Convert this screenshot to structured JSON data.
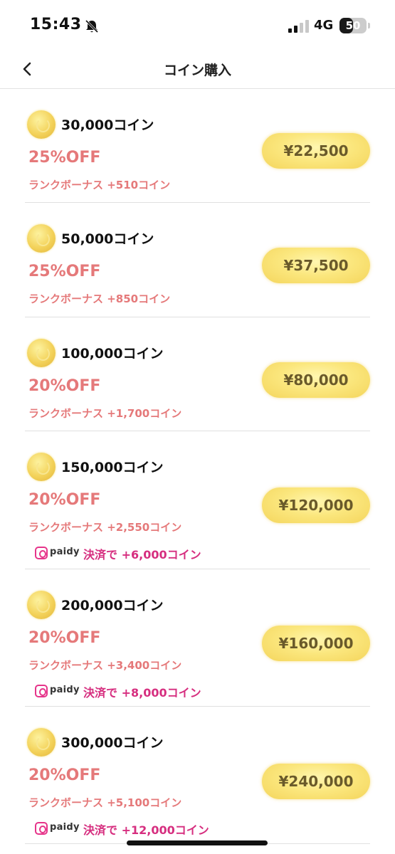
{
  "status_bar": {
    "time": "15:43",
    "network": "4G",
    "battery": "50",
    "battery_level_percent": 50
  },
  "nav": {
    "title": "コイン購入",
    "back_icon": "chevron-left-icon"
  },
  "items": [
    {
      "coins": "30,000コイン",
      "discount": "25%OFF",
      "bonus": "ランクボーナス +510コイン",
      "price": "¥22,500"
    },
    {
      "coins": "50,000コイン",
      "discount": "25%OFF",
      "bonus": "ランクボーナス +850コイン",
      "price": "¥37,500"
    },
    {
      "coins": "100,000コイン",
      "discount": "20%OFF",
      "bonus": "ランクボーナス +1,700コイン",
      "price": "¥80,000"
    },
    {
      "coins": "150,000コイン",
      "discount": "20%OFF",
      "bonus": "ランクボーナス +2,550コイン",
      "paidy_label": "paidy",
      "paidy_promo": "決済で +6,000コイン",
      "price": "¥120,000"
    },
    {
      "coins": "200,000コイン",
      "discount": "20%OFF",
      "bonus": "ランクボーナス +3,400コイン",
      "paidy_label": "paidy",
      "paidy_promo": "決済で +8,000コイン",
      "price": "¥160,000"
    },
    {
      "coins": "300,000コイン",
      "discount": "20%OFF",
      "bonus": "ランクボーナス +5,100コイン",
      "paidy_label": "paidy",
      "paidy_promo": "決済で +12,000コイン",
      "price": "¥240,000"
    }
  ],
  "colors": {
    "discount": "#e5797a",
    "paidy_promo": "#d62e7f",
    "price_button": "#fbe77e",
    "price_text": "#6a5a2a"
  }
}
